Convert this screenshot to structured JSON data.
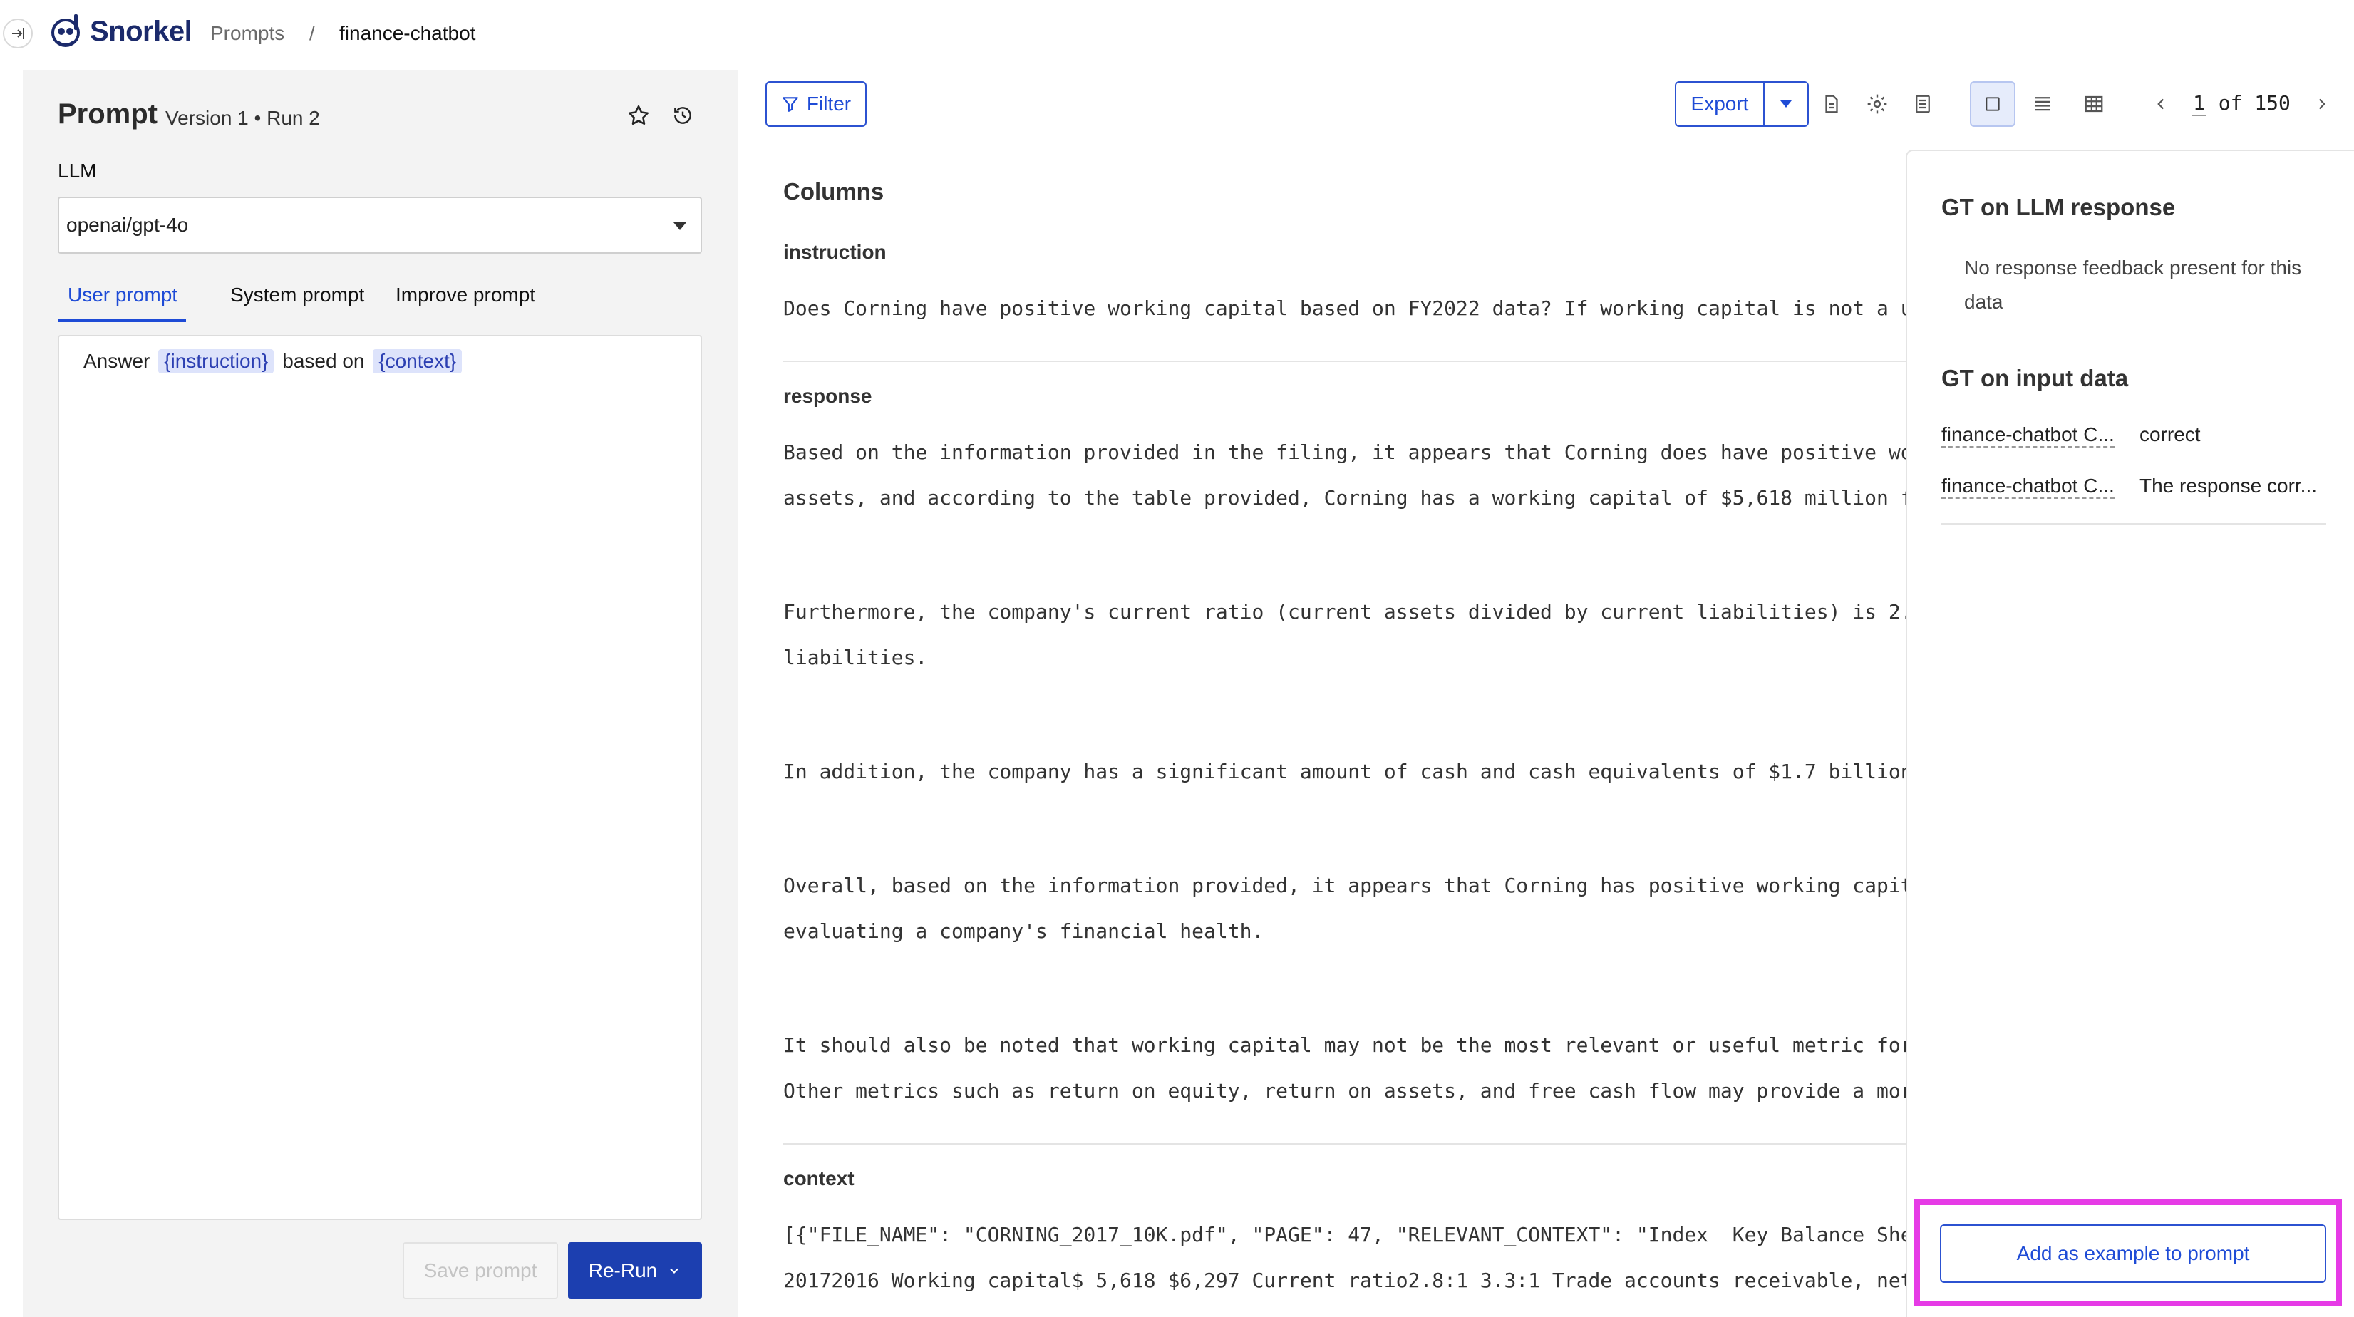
{
  "app": {
    "brand": "Snorkel"
  },
  "breadcrumb": {
    "root": "Prompts",
    "separator": "/",
    "current": "finance-chatbot"
  },
  "prompt_panel": {
    "title": "Prompt",
    "version": "Version 1 • Run 2",
    "llm_label": "LLM",
    "llm_value": "openai/gpt-4o",
    "tabs": [
      {
        "label": "User prompt",
        "active": true
      },
      {
        "label": "System prompt",
        "active": false
      },
      {
        "label": "Improve prompt",
        "active": false
      }
    ],
    "editor": {
      "prefix": "Answer",
      "var1": "{instruction}",
      "middle": "based on",
      "var2": "{context}"
    },
    "save_label": "Save prompt",
    "rerun_label": "Re-Run"
  },
  "toolbar": {
    "filter_label": "Filter",
    "export_label": "Export",
    "pager_current": "1",
    "pager_of": "of 150"
  },
  "main": {
    "columns_heading": "Columns",
    "instruction_label": "instruction",
    "instruction_text": "Does Corning have positive working capital based on FY2022 data? If working capital is not a u",
    "response_label": "response",
    "response_lines": [
      "Based on the information provided in the filing, it appears that Corning does have positive wo",
      "assets, and according to the table provided, Corning has a working capital of $5,618 million f",
      "Furthermore, the company's current ratio (current assets divided by current liabilities) is 2.",
      "liabilities.",
      "In addition, the company has a significant amount of cash and cash equivalents of $1.7 billion",
      "Overall, based on the information provided, it appears that Corning has positive working capit",
      "evaluating a company's financial health.",
      "It should also be noted that working capital may not be the most relevant or useful metric for",
      "Other metrics such as return on equity, return on assets, and free cash flow may provide a mor"
    ],
    "context_label": "context",
    "context_lines": [
      "[{\"FILE_NAME\": \"CORNING_2017_10K.pdf\", \"PAGE\": 47, \"RELEVANT_CONTEXT\": \"Index  Key Balance She",
      "20172016 Working capital$ 5,618 $6,297 Current ratio2.8:1 3.3:1 Trade accounts receivable, net"
    ]
  },
  "gt_panel": {
    "llm_heading": "GT on LLM response",
    "llm_note": "No response feedback present for this data",
    "input_heading": "GT on input data",
    "rows": [
      {
        "key": "finance-chatbot C...",
        "value": "correct"
      },
      {
        "key": "finance-chatbot C...",
        "value": "The response corr..."
      }
    ],
    "add_example_label": "Add as example to prompt"
  },
  "colors": {
    "accent": "#1e4bd6",
    "primary_button": "#1c3fb0",
    "highlight": "#e63be6",
    "chip_bg": "#dde3fb"
  },
  "icons": [
    "collapse-sidebar-icon",
    "snorkel-logo-icon",
    "star-icon",
    "history-icon",
    "filter-icon",
    "document-icon",
    "settings-icon",
    "list-icon",
    "single-view-icon",
    "lines-view-icon",
    "table-view-icon",
    "chevron-left-icon",
    "chevron-right-icon",
    "chevron-down-icon"
  ]
}
